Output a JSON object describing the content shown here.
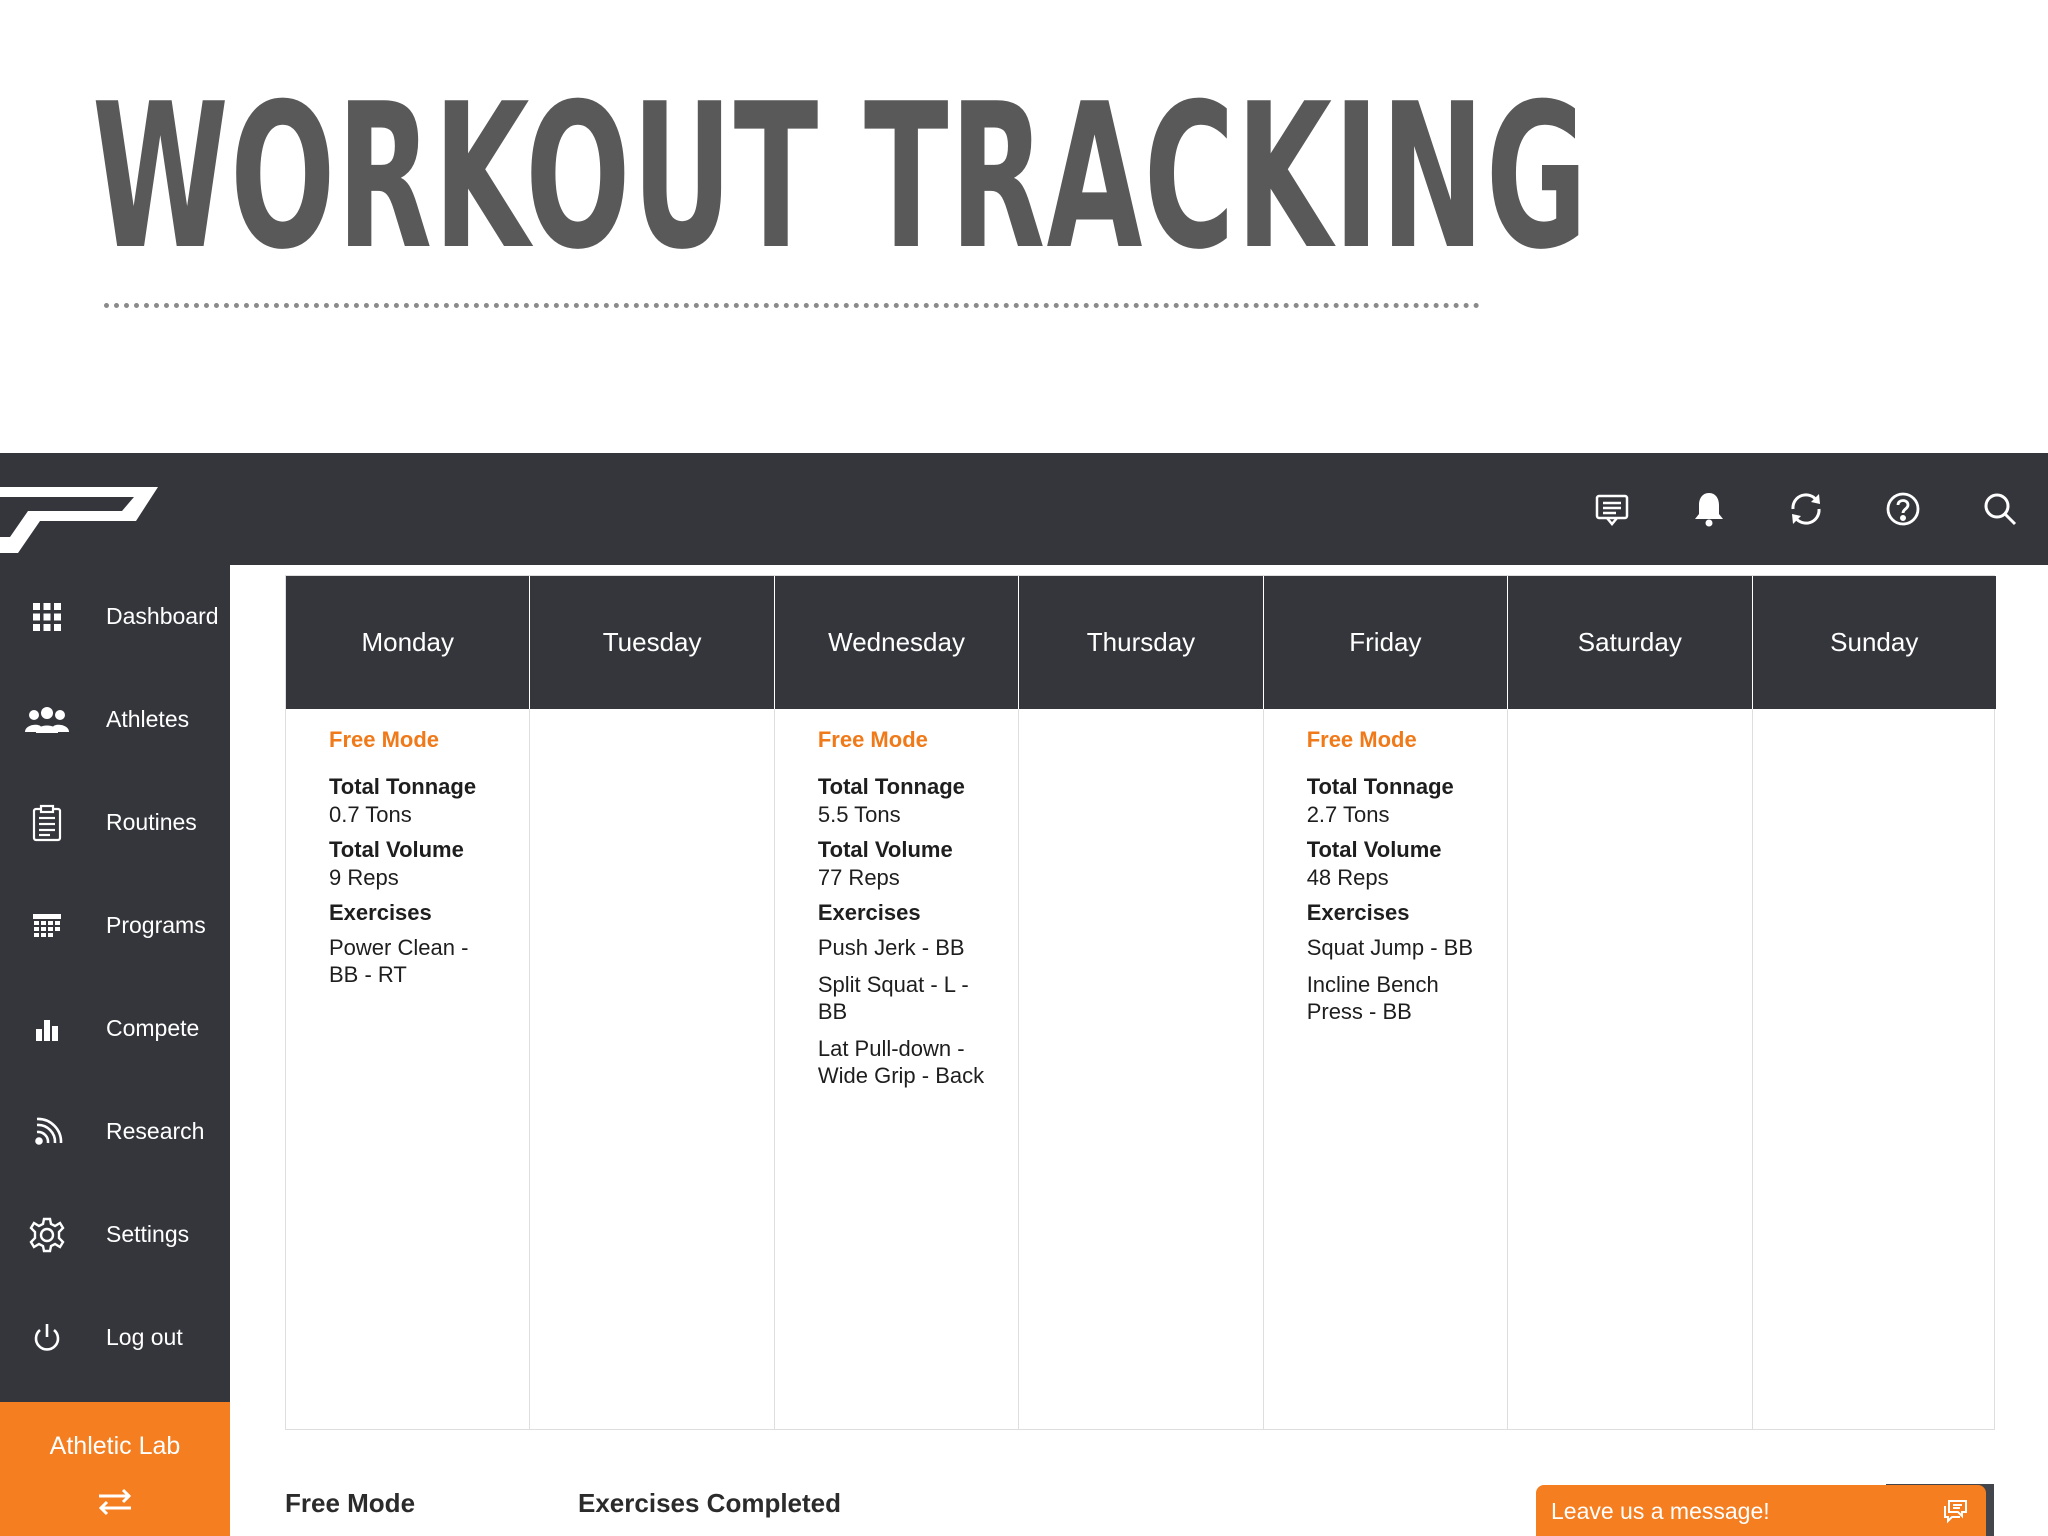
{
  "slide": {
    "title": "WORKOUT TRACKING"
  },
  "header_icons": [
    "messages-icon",
    "bell-icon",
    "sync-icon",
    "help-icon",
    "search-icon"
  ],
  "sidebar": {
    "items": [
      {
        "label": "Dashboard",
        "icon": "grid-icon"
      },
      {
        "label": "Athletes",
        "icon": "people-icon"
      },
      {
        "label": "Routines",
        "icon": "clipboard-icon"
      },
      {
        "label": "Programs",
        "icon": "calendar-icon"
      },
      {
        "label": "Compete",
        "icon": "bar-chart-icon"
      },
      {
        "label": "Research",
        "icon": "rss-icon"
      },
      {
        "label": "Settings",
        "icon": "gear-icon"
      },
      {
        "label": "Log out",
        "icon": "power-icon"
      }
    ],
    "brand": "Athletic Lab",
    "brand_icon": "swap-arrows-icon"
  },
  "calendar": {
    "days": [
      {
        "name": "Monday",
        "mode": "Free Mode",
        "tonnage_label": "Total Tonnage",
        "tonnage": "0.7 Tons",
        "volume_label": "Total Volume",
        "volume": "9 Reps",
        "exercises_label": "Exercises",
        "exercises": [
          "Power Clean - BB - RT"
        ]
      },
      {
        "name": "Tuesday"
      },
      {
        "name": "Wednesday",
        "mode": "Free Mode",
        "tonnage_label": "Total Tonnage",
        "tonnage": "5.5 Tons",
        "volume_label": "Total Volume",
        "volume": "77 Reps",
        "exercises_label": "Exercises",
        "exercises": [
          "Push Jerk - BB",
          "Split Squat - L - BB",
          "Lat Pull-down - Wide Grip - Back"
        ]
      },
      {
        "name": "Thursday"
      },
      {
        "name": "Friday",
        "mode": "Free Mode",
        "tonnage_label": "Total Tonnage",
        "tonnage": "2.7 Tons",
        "volume_label": "Total Volume",
        "volume": "48 Reps",
        "exercises_label": "Exercises",
        "exercises": [
          "Squat Jump - BB",
          "Incline Bench Press - BB"
        ]
      },
      {
        "name": "Saturday"
      },
      {
        "name": "Sunday"
      }
    ]
  },
  "bottom": {
    "left_label": "Free Mode",
    "right_label": "Exercises Completed"
  },
  "chat": {
    "label": "Leave us a message!",
    "icon": "chat-bubbles-icon"
  },
  "colors": {
    "bar": "#34363c",
    "accent": "#f47e20",
    "mode_text": "#f07a19",
    "title": "#595959"
  }
}
